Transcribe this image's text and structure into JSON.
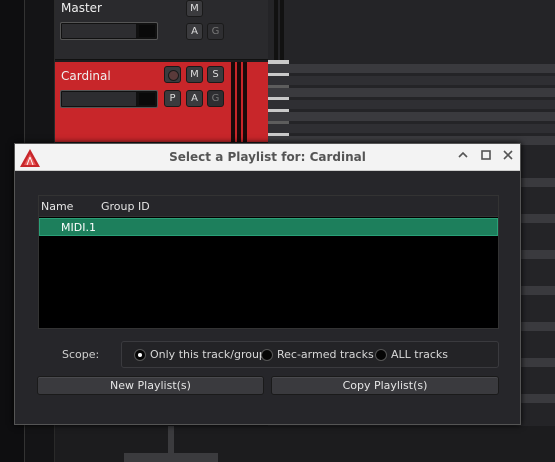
{
  "tracks": {
    "master": {
      "name": "Master",
      "buttons": [
        "M",
        "A",
        "G"
      ]
    },
    "cardinal": {
      "name": "Cardinal",
      "buttons": [
        "M",
        "S",
        "P",
        "A",
        "G"
      ],
      "color": "#c8262a"
    }
  },
  "dialog": {
    "title": "Select a Playlist for: Cardinal",
    "window_buttons": [
      "^",
      "□",
      "×"
    ],
    "columns": {
      "name": "Name",
      "group_id": "Group ID"
    },
    "rows": [
      {
        "name": "MIDI.1",
        "group_id": ""
      }
    ],
    "scope": {
      "label": "Scope:",
      "options": [
        "Only this track/group",
        "Rec-armed tracks",
        "ALL tracks"
      ],
      "selected": "Only this track/group"
    },
    "buttons": {
      "new": "New Playlist(s)",
      "copy": "Copy Playlist(s)"
    },
    "colors": {
      "selection": "#1d7f5c",
      "accent": "#c8262a"
    }
  }
}
